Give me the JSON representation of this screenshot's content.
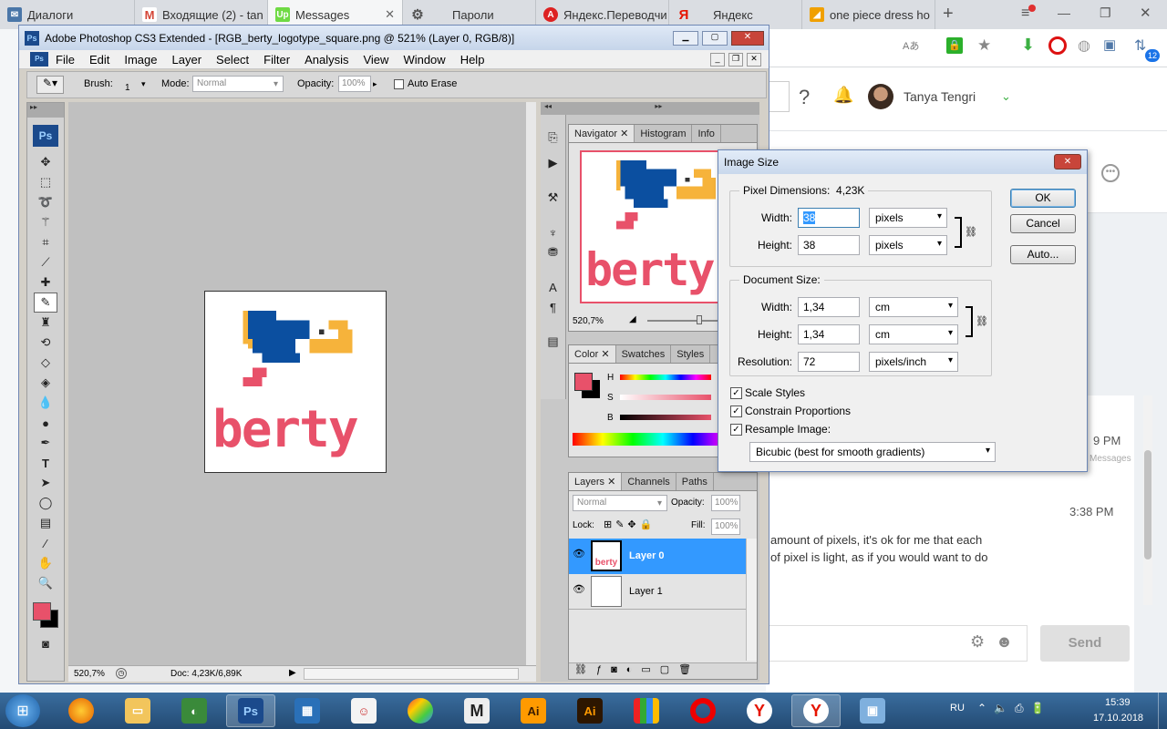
{
  "browser": {
    "tabs": [
      {
        "label": "Диалоги",
        "icon": "dialog-icon",
        "color": "#4a76a8"
      },
      {
        "label": "Входящие (2) - tan",
        "icon": "gmail-icon",
        "color": "#d44638"
      },
      {
        "label": "Messages",
        "icon": "upwork-icon",
        "color": "#6fda44"
      },
      {
        "label": "Пароли",
        "icon": "gear-icon",
        "color": "#666666"
      },
      {
        "label": "Яндекс.Переводчи",
        "icon": "translate-icon",
        "color": "#d22"
      },
      {
        "label": "Яндекс",
        "icon": "yandex-icon",
        "color": "#e61400"
      },
      {
        "label": "one piece dress ho",
        "icon": "aliexpress-icon",
        "color": "#f0a000"
      }
    ],
    "new_tab": "+",
    "user_name": "Tanya Tengri",
    "notif_badge": "12"
  },
  "chat": {
    "time_partial": "9 PM",
    "messages_label": "Messages",
    "time2": "3:38 PM",
    "msg_line1": "amount of pixels, it's ok for me that each",
    "msg_line2": "of pixel is light, as if you would want to do",
    "send_label": "Send"
  },
  "photoshop": {
    "title": "Adobe Photoshop CS3 Extended - [RGB_berty_logotype_square.png @ 521% (Layer 0, RGB/8)]",
    "menu": [
      "File",
      "Edit",
      "Image",
      "Layer",
      "Select",
      "Filter",
      "Analysis",
      "View",
      "Window",
      "Help"
    ],
    "options": {
      "brush_label": "Brush:",
      "brush_size": "1",
      "mode_label": "Mode:",
      "mode_value": "Normal",
      "opacity_label": "Opacity:",
      "opacity_value": "100%",
      "auto_erase": "Auto Erase"
    },
    "status": {
      "zoom": "520,7%",
      "doc": "Doc: 4,23K/6,89K"
    },
    "ps_logo": "Ps",
    "navigator": {
      "tabs": [
        "Navigator",
        "Histogram",
        "Info"
      ],
      "zoom": "520,7%"
    },
    "color_panel": {
      "tabs": [
        "Color",
        "Swatches",
        "Styles"
      ],
      "labels": [
        "H",
        "S",
        "B"
      ]
    },
    "layers_panel": {
      "tabs": [
        "Layers",
        "Channels",
        "Paths"
      ],
      "blend": "Normal",
      "opacity_label": "Opacity:",
      "opacity_value": "100%",
      "lock_label": "Lock:",
      "fill_label": "Fill:",
      "fill_value": "100%",
      "layers": [
        "Layer 0",
        "Layer 1"
      ]
    },
    "logo_text": "berty"
  },
  "dialog": {
    "title": "Image Size",
    "pixel_dimensions_label": "Pixel Dimensions:",
    "pixel_dimensions_value": "4,23K",
    "width_label": "Width:",
    "height_label": "Height:",
    "px_width": "38",
    "px_height": "38",
    "px_unit": "pixels",
    "doc_size_label": "Document Size:",
    "doc_width": "1,34",
    "doc_height": "1,34",
    "doc_unit": "cm",
    "resolution_label": "Resolution:",
    "resolution": "72",
    "resolution_unit": "pixels/inch",
    "scale_styles": "Scale Styles",
    "constrain": "Constrain Proportions",
    "resample": "Resample Image:",
    "resample_method": "Bicubic (best for smooth gradients)",
    "ok": "OK",
    "cancel": "Cancel",
    "auto": "Auto..."
  },
  "taskbar": {
    "lang": "RU",
    "time": "15:39",
    "date": "17.10.2018"
  }
}
